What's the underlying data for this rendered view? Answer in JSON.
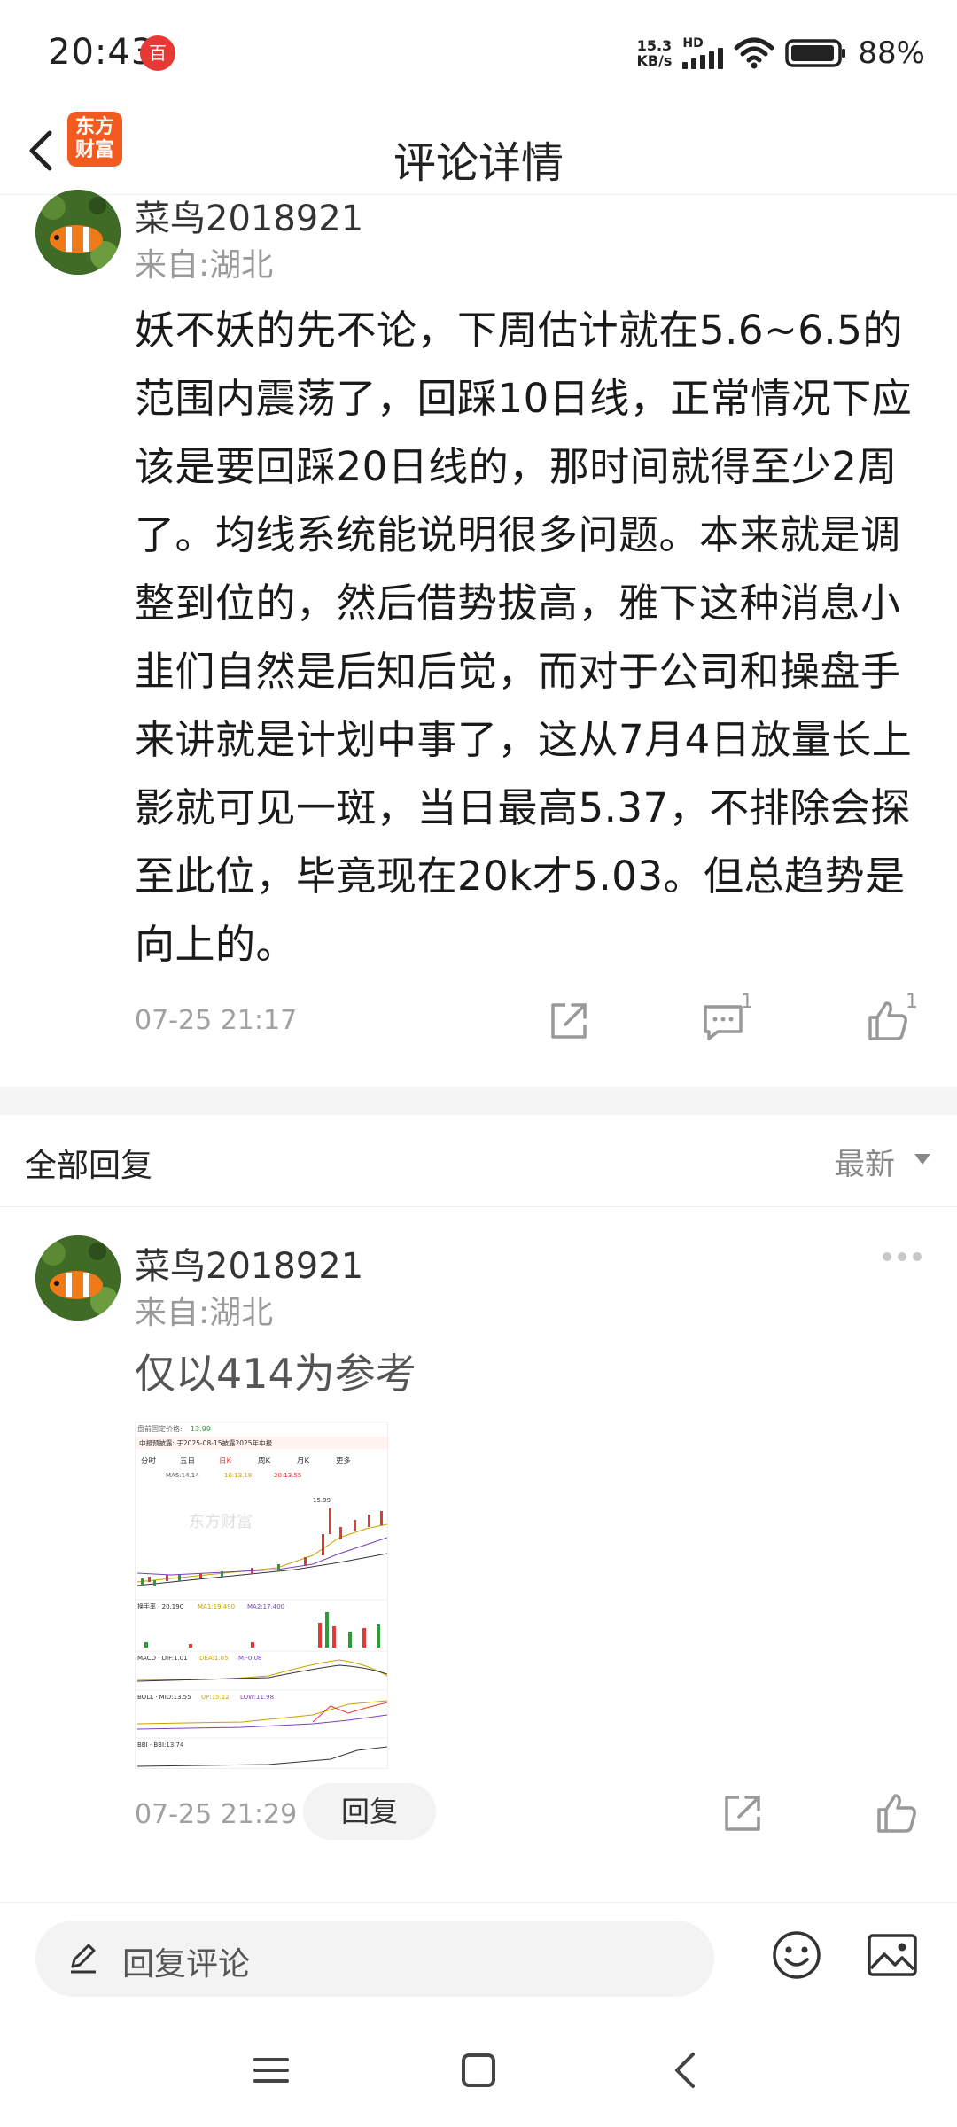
{
  "status_bar": {
    "time": "20:43",
    "app_badge": "百",
    "net_speed_value": "15.3",
    "net_speed_unit": "KB/s",
    "net_type": "HD",
    "battery": "88%"
  },
  "header": {
    "title": "评论详情",
    "brand_line1": "东方",
    "brand_line2": "财富"
  },
  "main_comment": {
    "username": "菜鸟2018921",
    "location": "来自:湖北",
    "body": "妖不妖的先不论，下周估计就在5.6~6.5的范围内震荡了，回踩10日线，正常情况下应该是要回踩20日线的，那时间就得至少2周了。均线系统能说明很多问题。本来就是调整到位的，然后借势拔高，雅下这种消息小韭们自然是后知后觉，而对于公司和操盘手来讲就是计划中事了，这从7月4日放量长上影就可见一斑，当日最高5.37，不排除会探至此位，毕竟现在20k才5.03。但总趋势是向上的。",
    "timestamp": "07-25 21:17",
    "comment_count": "1",
    "like_count": "1"
  },
  "replies_section": {
    "title": "全部回复",
    "sort_label": "最新"
  },
  "reply": {
    "username": "菜鸟2018921",
    "location": "来自:湖北",
    "body": "仅以414为参考",
    "timestamp": "07-25 21:29",
    "reply_button": "回复"
  },
  "chart_thumb": {
    "price_label": "盘前固定价格:",
    "price": "13.99",
    "notice": "中报预披露: 于2025-08-15披露2025年中报",
    "tabs": [
      "分时",
      "五日",
      "日K",
      "周K",
      "月K",
      "更多"
    ],
    "ma5": "MA5:14.14",
    "ma10": "10:13.18",
    "ma20": "20:13.55",
    "vol_label": "换手率 · 20.190",
    "ma1": "MA1:19.490",
    "ma2": "MA2:17.400",
    "macd_label": "MACD · DIF:1.01",
    "dea": "DEA:1.05",
    "m": "M:-0.08",
    "boll_label": "BOLL · MID:13.55",
    "up": "UP:15.12",
    "low": "LOW:11.98",
    "bbi_label": "BBI · BBI:13.74",
    "high": "15.99",
    "watermark": "东方财富"
  },
  "bottom_bar": {
    "reply_placeholder": "回复评论"
  },
  "colors": {
    "brand_orange": "#f25a1f",
    "chart_red": "#e53935",
    "chart_green": "#2e9b3a"
  }
}
